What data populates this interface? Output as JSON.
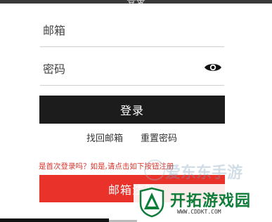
{
  "header": {
    "title": "登录"
  },
  "form": {
    "email_placeholder": "邮箱",
    "password_placeholder": "密码",
    "show_password_icon": "eye-icon",
    "login_label": "登录",
    "find_email_label": "找回邮箱",
    "reset_password_label": "重置密码",
    "first_time_hint": "是首次登录吗？如是,请点击如下按钮注册",
    "register_label": "邮箱注册"
  },
  "watermarks": {
    "top_text": "爱东东手游",
    "brand_name": "开拓游戏园",
    "brand_url": "WWW.CDDKT.COM"
  },
  "colors": {
    "login_button": "#1c1c1c",
    "register_button": "#e8322a",
    "hint_text": "#d9342b",
    "brand_green": "#0f7d3a"
  }
}
